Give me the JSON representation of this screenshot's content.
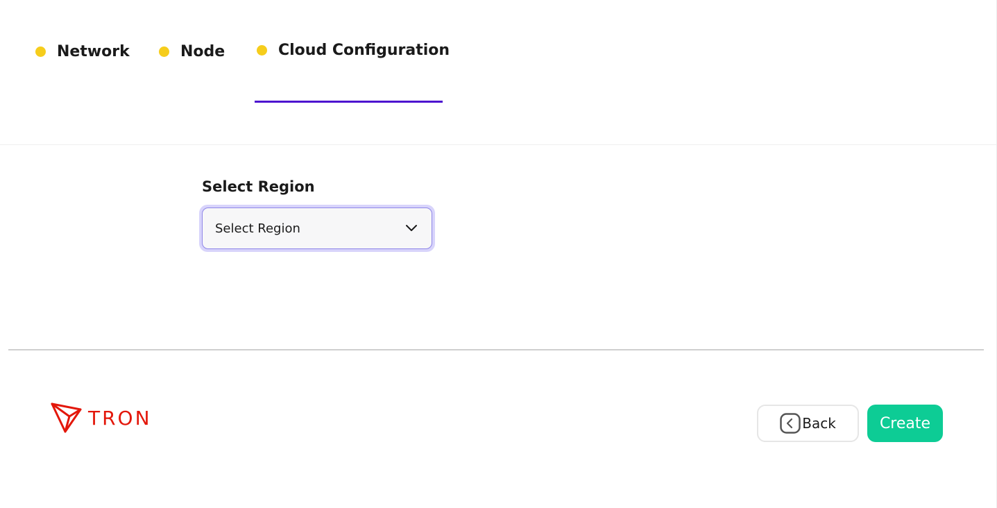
{
  "colors": {
    "step_dot": "#f6cd1c",
    "active_underline": "#4c12cf",
    "select_focus_ring": "#d8d4fb",
    "create_button": "#0dcc95",
    "brand_red": "#e3170a"
  },
  "steps": [
    {
      "label": "Network",
      "icon": "dot-icon",
      "active": false
    },
    {
      "label": "Node",
      "icon": "dot-icon",
      "active": false
    },
    {
      "label": "Cloud Configuration",
      "icon": "dot-icon",
      "active": true
    }
  ],
  "region": {
    "label": "Select Region",
    "selected_value": "Select Region",
    "icon": "chevron-down-icon"
  },
  "footer": {
    "logo_text": "TRON",
    "back_label": "Back",
    "back_icon": "chevron-left-icon",
    "create_label": "Create"
  }
}
